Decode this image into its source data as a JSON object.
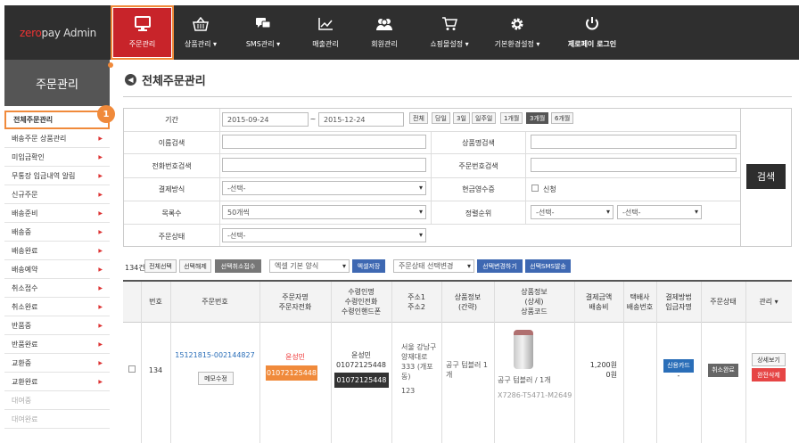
{
  "header": {
    "logo_prefix": "zero",
    "logo_rest": "pay Admin",
    "nav": [
      {
        "label": "주문관리",
        "icon": "monitor-icon",
        "active": true
      },
      {
        "label": "상품관리 ▾",
        "icon": "basket-icon"
      },
      {
        "label": "SMS관리 ▾",
        "icon": "chat-icon"
      },
      {
        "label": "매출관리",
        "icon": "chart-icon"
      },
      {
        "label": "회원관리",
        "icon": "users-icon"
      },
      {
        "label": "쇼핑몰설정 ▾",
        "icon": "cart-icon"
      },
      {
        "label": "기본환경설정 ▾",
        "icon": "gear-icon"
      },
      {
        "label": "제로페이 로그인",
        "icon": "power-icon"
      }
    ]
  },
  "sidebar": {
    "title": "주문관리",
    "badge": "1",
    "items": [
      {
        "label": "전체주문관리",
        "selected": true
      },
      {
        "label": "배송주문 상품관리"
      },
      {
        "label": "미입금확인"
      },
      {
        "label": "무통장 입금내역 알림"
      },
      {
        "label": "신규주문"
      },
      {
        "label": "배송준비"
      },
      {
        "label": "배송중"
      },
      {
        "label": "배송완료"
      },
      {
        "label": "배송예약"
      },
      {
        "label": "취소접수"
      },
      {
        "label": "취소완료"
      },
      {
        "label": "반품중"
      },
      {
        "label": "반품완료"
      },
      {
        "label": "교환중"
      },
      {
        "label": "교환완료"
      },
      {
        "label": "대여중",
        "dim": true
      },
      {
        "label": "대여완료",
        "dim": true
      }
    ]
  },
  "page": {
    "title": "전체주문관리"
  },
  "search": {
    "period_label": "기간",
    "date_from": "2015-09-24",
    "date_sep": "~",
    "date_to": "2015-12-24",
    "periods": [
      "전체",
      "당일",
      "3일",
      "일주일",
      "1개월",
      "3개월",
      "6개월"
    ],
    "active_period": "3개월",
    "name_label": "이름검색",
    "product_label": "상품명검색",
    "phone_label": "전화번호검색",
    "orderno_label": "주문번호검색",
    "paymethod_label": "결제방식",
    "paymethod_value": "-선택-",
    "receipt_label": "현금영수증",
    "receipt_check": "신청",
    "listcount_label": "목록수",
    "listcount_value": "50개씩",
    "sort_label": "정렬순위",
    "sort_value1": "-선택-",
    "sort_value2": "-선택-",
    "status_label": "주문상태",
    "status_value": "-선택-",
    "search_button": "검색"
  },
  "actions": {
    "count": "134건",
    "select_all": "전체선택",
    "deselect": "선택해제",
    "cancel_selected": "선택취소접수",
    "excel_format": "엑셀 기본 양식",
    "excel_save": "엑셀저장",
    "status_change_select": "주문상태 선택변경",
    "apply_change": "선택변경하기",
    "send_sms": "선택SMS발송"
  },
  "table": {
    "headers": [
      "번호",
      "주문번호",
      "주문자명\n주문자전화",
      "수령인명\n수령인전화\n수령인핸드폰",
      "주소1\n주소2",
      "상품정보\n(간략)",
      "상품정보\n(상세)\n상품코드",
      "결제금액\n배송비",
      "택배사\n배송번호",
      "결제방법\n입금자명",
      "주문상태",
      "관리 ▾"
    ],
    "rows": [
      {
        "no": "134",
        "order_no": "15121815-002144827",
        "memo_btn": "메모수정",
        "buyer_name": "윤성민",
        "buyer_phone": "01072125448",
        "recv_name": "윤성민",
        "recv_phone": "01072125448",
        "recv_mobile": "01072125448",
        "address": "서울 강남구 양재대로 333 (개포동)",
        "address2": "123",
        "product_short": "공구 텀블러 1개",
        "product_detail": "공구 텀블러 / 1개",
        "product_code": "X7286-T5471-M2649",
        "amount": "1,200원",
        "shipping": "0원",
        "pay_method": "신용카드",
        "payer": "-",
        "status": "취소완료",
        "detail_btn": "상세보기",
        "delete_btn": "완전삭제"
      }
    ]
  }
}
